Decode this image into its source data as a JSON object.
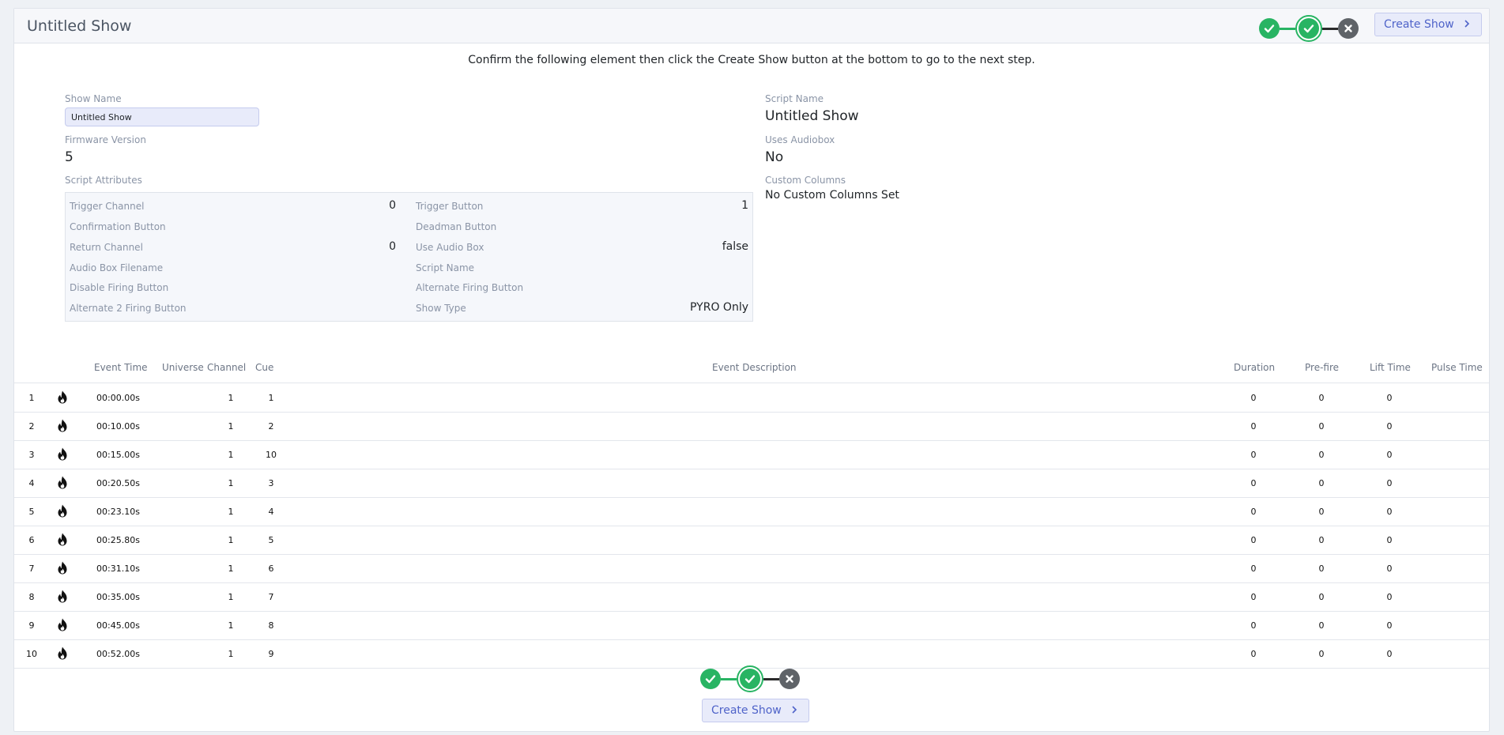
{
  "header": {
    "title": "Untitled Show",
    "create_label": "Create Show"
  },
  "instruction": "Confirm the following element then click the Create Show button at the bottom to go to the next step.",
  "details": {
    "show_name_label": "Show Name",
    "show_name_value": "Untitled Show",
    "firmware_label": "Firmware Version",
    "firmware_value": "5",
    "script_attributes_label": "Script Attributes",
    "script_name_label": "Script Name",
    "script_name_value": "Untitled Show",
    "uses_audiobox_label": "Uses Audiobox",
    "uses_audiobox_value": "No",
    "custom_columns_label": "Custom Columns",
    "custom_columns_value": "No Custom Columns Set"
  },
  "attributes": [
    {
      "left_name": "Trigger Channel",
      "left_value": "0",
      "right_name": "Trigger Button",
      "right_value": "1"
    },
    {
      "left_name": "Confirmation Button",
      "left_value": "",
      "right_name": "Deadman Button",
      "right_value": ""
    },
    {
      "left_name": "Return Channel",
      "left_value": "0",
      "right_name": "Use Audio Box",
      "right_value": "false"
    },
    {
      "left_name": "Audio Box Filename",
      "left_value": "",
      "right_name": "Script Name",
      "right_value": ""
    },
    {
      "left_name": "Disable Firing Button",
      "left_value": "",
      "right_name": "Alternate Firing Button",
      "right_value": ""
    },
    {
      "left_name": "Alternate 2 Firing Button",
      "left_value": "",
      "right_name": "Show Type",
      "right_value": "PYRO Only"
    }
  ],
  "table": {
    "headers": {
      "event_time": "Event Time",
      "universe": "Universe",
      "channel": "Channel",
      "cue": "Cue",
      "description": "Event Description",
      "duration": "Duration",
      "prefire": "Pre-fire",
      "lift_time": "Lift Time",
      "pulse_time": "Pulse Time"
    },
    "icon": "flame-icon",
    "rows": [
      {
        "num": "1",
        "time": "00:00.00s",
        "universe": "",
        "channel": "1",
        "cue": "1",
        "description": "",
        "duration": "0",
        "prefire": "0",
        "lift": "0",
        "pulse": ""
      },
      {
        "num": "2",
        "time": "00:10.00s",
        "universe": "",
        "channel": "1",
        "cue": "2",
        "description": "",
        "duration": "0",
        "prefire": "0",
        "lift": "0",
        "pulse": ""
      },
      {
        "num": "3",
        "time": "00:15.00s",
        "universe": "",
        "channel": "1",
        "cue": "10",
        "description": "",
        "duration": "0",
        "prefire": "0",
        "lift": "0",
        "pulse": ""
      },
      {
        "num": "4",
        "time": "00:20.50s",
        "universe": "",
        "channel": "1",
        "cue": "3",
        "description": "",
        "duration": "0",
        "prefire": "0",
        "lift": "0",
        "pulse": ""
      },
      {
        "num": "5",
        "time": "00:23.10s",
        "universe": "",
        "channel": "1",
        "cue": "4",
        "description": "",
        "duration": "0",
        "prefire": "0",
        "lift": "0",
        "pulse": ""
      },
      {
        "num": "6",
        "time": "00:25.80s",
        "universe": "",
        "channel": "1",
        "cue": "5",
        "description": "",
        "duration": "0",
        "prefire": "0",
        "lift": "0",
        "pulse": ""
      },
      {
        "num": "7",
        "time": "00:31.10s",
        "universe": "",
        "channel": "1",
        "cue": "6",
        "description": "",
        "duration": "0",
        "prefire": "0",
        "lift": "0",
        "pulse": ""
      },
      {
        "num": "8",
        "time": "00:35.00s",
        "universe": "",
        "channel": "1",
        "cue": "7",
        "description": "",
        "duration": "0",
        "prefire": "0",
        "lift": "0",
        "pulse": ""
      },
      {
        "num": "9",
        "time": "00:45.00s",
        "universe": "",
        "channel": "1",
        "cue": "8",
        "description": "",
        "duration": "0",
        "prefire": "0",
        "lift": "0",
        "pulse": ""
      },
      {
        "num": "10",
        "time": "00:52.00s",
        "universe": "",
        "channel": "1",
        "cue": "9",
        "description": "",
        "duration": "0",
        "prefire": "0",
        "lift": "0",
        "pulse": ""
      }
    ]
  },
  "footer": {
    "create_label": "Create Show"
  },
  "colors": {
    "step_done": "#28b463",
    "step_pending": "#5f6368",
    "accent": "#4f63c9"
  }
}
